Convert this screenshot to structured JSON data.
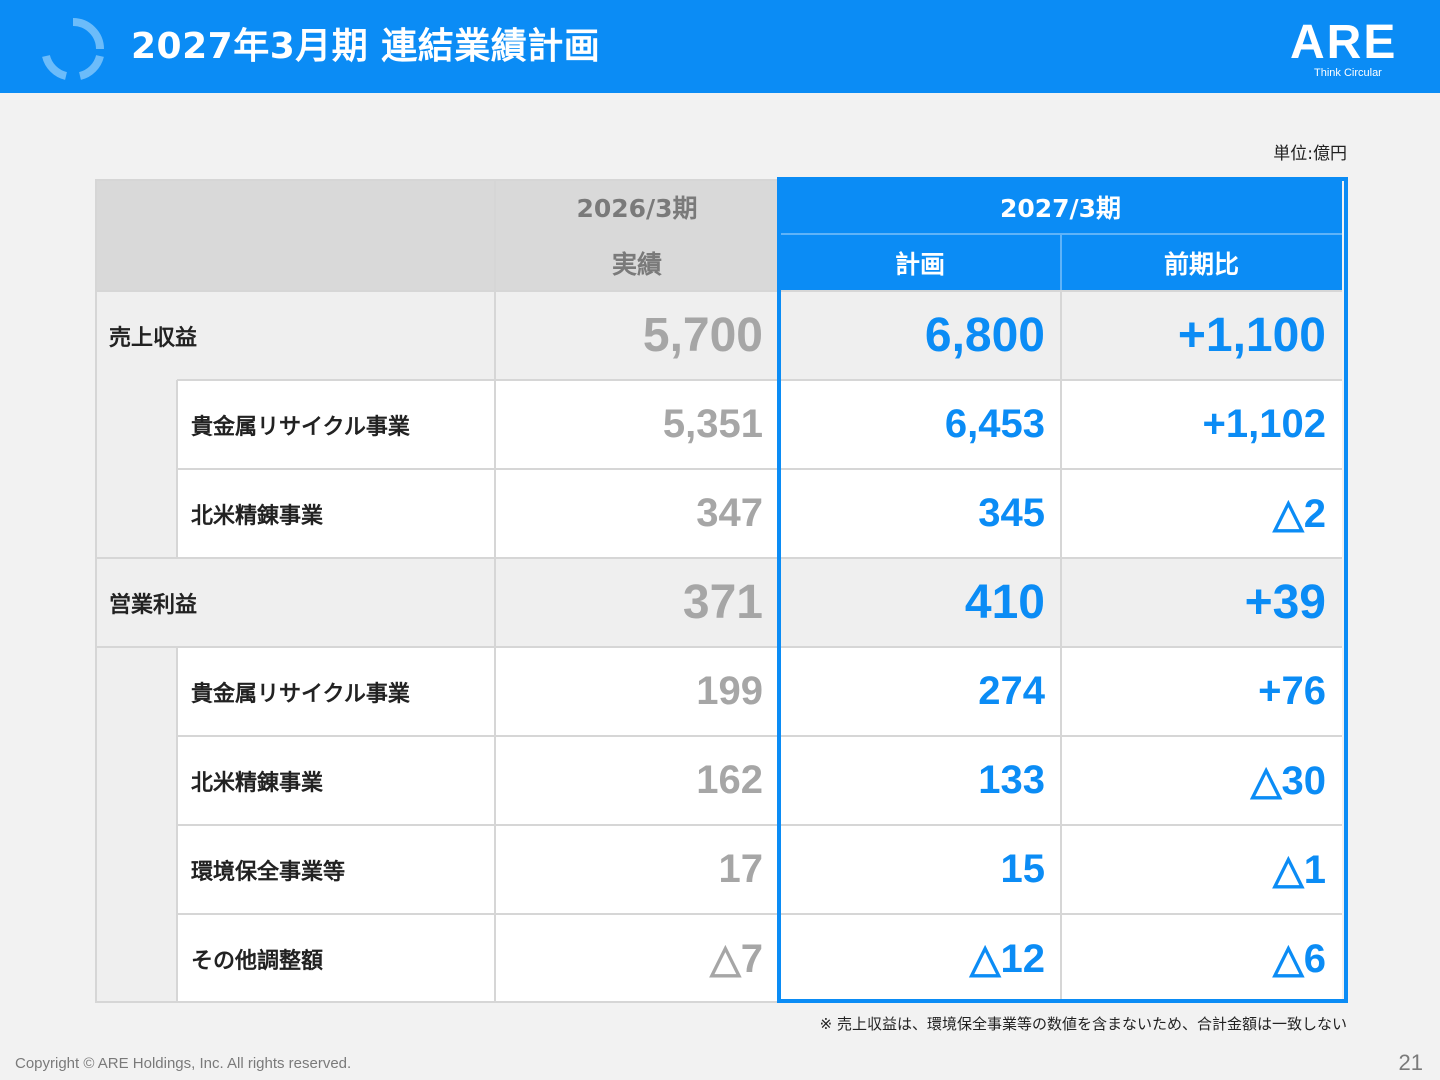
{
  "header": {
    "title": "2027年3月期 連結業績計画",
    "logo_text": "ARE",
    "logo_tagline": "Think Circular",
    "accent_color": "#0b8cf5"
  },
  "unit_label": "単位:億円",
  "table": {
    "col_prev_period": "2026/3期",
    "col_prev_sub": "実績",
    "col_next_period": "2027/3期",
    "col_next_plan": "計画",
    "col_next_yoy": "前期比",
    "rows": [
      {
        "label": "売上収益",
        "actual": "5,700",
        "plan": "6,800",
        "yoy": "+1,100"
      },
      {
        "label": "貴金属リサイクル事業",
        "actual": "5,351",
        "plan": "6,453",
        "yoy": "+1,102"
      },
      {
        "label": "北米精錬事業",
        "actual": "347",
        "plan": "345",
        "yoy": "△2"
      },
      {
        "label": "営業利益",
        "actual": "371",
        "plan": "410",
        "yoy": "+39"
      },
      {
        "label": "貴金属リサイクル事業",
        "actual": "199",
        "plan": "274",
        "yoy": "+76"
      },
      {
        "label": "北米精錬事業",
        "actual": "162",
        "plan": "133",
        "yoy": "△30"
      },
      {
        "label": "環境保全事業等",
        "actual": "17",
        "plan": "15",
        "yoy": "△1"
      },
      {
        "label": "その他調整額",
        "actual": "△7",
        "plan": "△12",
        "yoy": "△6"
      }
    ]
  },
  "footnote": "※ 売上収益は、環境保全事業等の数値を含まないため、合計金額は一致しない",
  "copyright": "Copyright © ARE Holdings, Inc. All rights reserved.",
  "page_number": "21"
}
